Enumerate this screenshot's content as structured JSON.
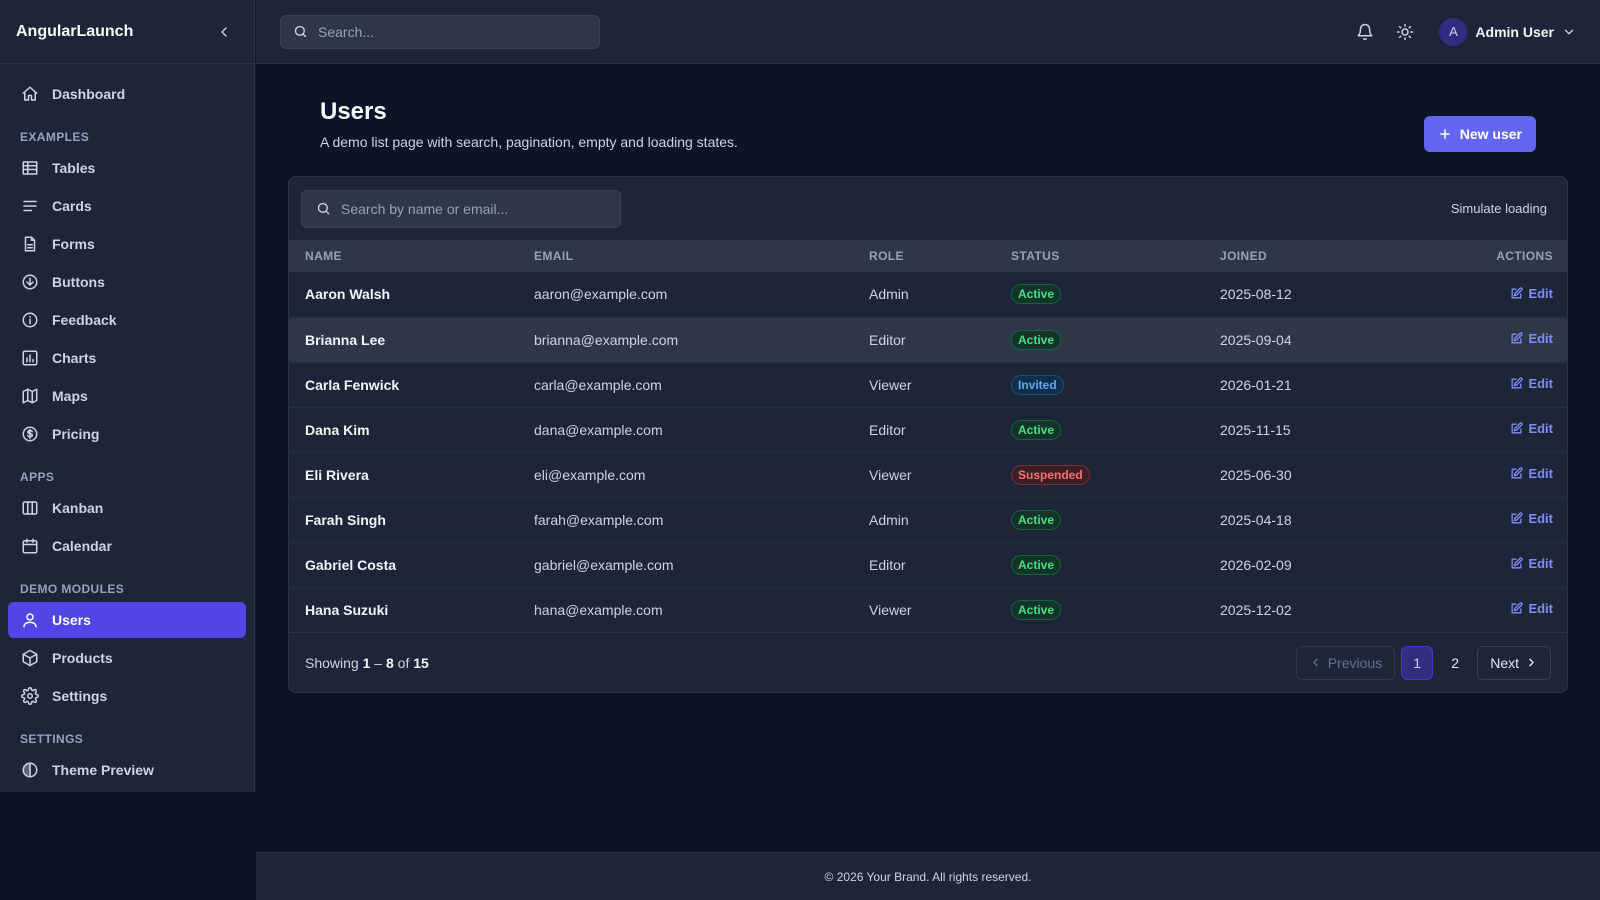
{
  "brand": {
    "name": "AngularLaunch"
  },
  "sidebar": {
    "dashboard": {
      "label": "Dashboard",
      "icon": "home-icon"
    },
    "sections": [
      {
        "title": "EXAMPLES",
        "items": [
          {
            "label": "Tables",
            "icon": "table-icon"
          },
          {
            "label": "Cards",
            "icon": "lines-icon"
          },
          {
            "label": "Forms",
            "icon": "document-icon"
          },
          {
            "label": "Buttons",
            "icon": "circle-arrow-down-icon"
          },
          {
            "label": "Feedback",
            "icon": "info-icon"
          },
          {
            "label": "Charts",
            "icon": "chart-icon"
          },
          {
            "label": "Maps",
            "icon": "map-icon"
          },
          {
            "label": "Pricing",
            "icon": "dollar-icon"
          }
        ]
      },
      {
        "title": "APPS",
        "items": [
          {
            "label": "Kanban",
            "icon": "columns-icon"
          },
          {
            "label": "Calendar",
            "icon": "calendar-icon"
          }
        ]
      },
      {
        "title": "DEMO MODULES",
        "items": [
          {
            "label": "Users",
            "icon": "user-icon",
            "active": true
          },
          {
            "label": "Products",
            "icon": "box-icon"
          },
          {
            "label": "Settings",
            "icon": "gear-icon"
          }
        ]
      },
      {
        "title": "SETTINGS",
        "items": [
          {
            "label": "Theme Preview",
            "icon": "theme-icon"
          }
        ]
      }
    ]
  },
  "topbar": {
    "search_placeholder": "Search...",
    "user_name": "Admin User",
    "avatar_initial": "A"
  },
  "page": {
    "title": "Users",
    "subtitle": "A demo list page with search, pagination, empty and loading states.",
    "new_user_label": "New user"
  },
  "list": {
    "search_placeholder": "Search by name or email...",
    "simulate_loading_label": "Simulate loading",
    "columns": [
      "NAME",
      "EMAIL",
      "ROLE",
      "STATUS",
      "JOINED",
      "ACTIONS"
    ],
    "edit_label": "Edit",
    "rows": [
      {
        "name": "Aaron Walsh",
        "email": "aaron@example.com",
        "role": "Admin",
        "status": "Active",
        "joined": "2025-08-12"
      },
      {
        "name": "Brianna Lee",
        "email": "brianna@example.com",
        "role": "Editor",
        "status": "Active",
        "joined": "2025-09-04"
      },
      {
        "name": "Carla Fenwick",
        "email": "carla@example.com",
        "role": "Viewer",
        "status": "Invited",
        "joined": "2026-01-21"
      },
      {
        "name": "Dana Kim",
        "email": "dana@example.com",
        "role": "Editor",
        "status": "Active",
        "joined": "2025-11-15"
      },
      {
        "name": "Eli Rivera",
        "email": "eli@example.com",
        "role": "Viewer",
        "status": "Suspended",
        "joined": "2025-06-30"
      },
      {
        "name": "Farah Singh",
        "email": "farah@example.com",
        "role": "Admin",
        "status": "Active",
        "joined": "2025-04-18"
      },
      {
        "name": "Gabriel Costa",
        "email": "gabriel@example.com",
        "role": "Editor",
        "status": "Active",
        "joined": "2026-02-09"
      },
      {
        "name": "Hana Suzuki",
        "email": "hana@example.com",
        "role": "Viewer",
        "status": "Active",
        "joined": "2025-12-02"
      }
    ],
    "footer": {
      "showing_prefix": "Showing",
      "range_start": "1",
      "range_sep": "–",
      "range_end": "8",
      "of_label": "of",
      "total": "15"
    },
    "pagination": {
      "previous_label": "Previous",
      "next_label": "Next",
      "pages": [
        "1",
        "2"
      ],
      "current_page": "1"
    }
  },
  "footer": {
    "copyright": "© 2026 Your Brand. All rights reserved."
  },
  "colors": {
    "accent": "#6366f1",
    "active_nav": "#4f46e5",
    "background": "#0c1527",
    "panel": "#1c2638",
    "status_active": "#4ade80",
    "status_invited": "#60a5fa",
    "status_suspended": "#f87171"
  }
}
